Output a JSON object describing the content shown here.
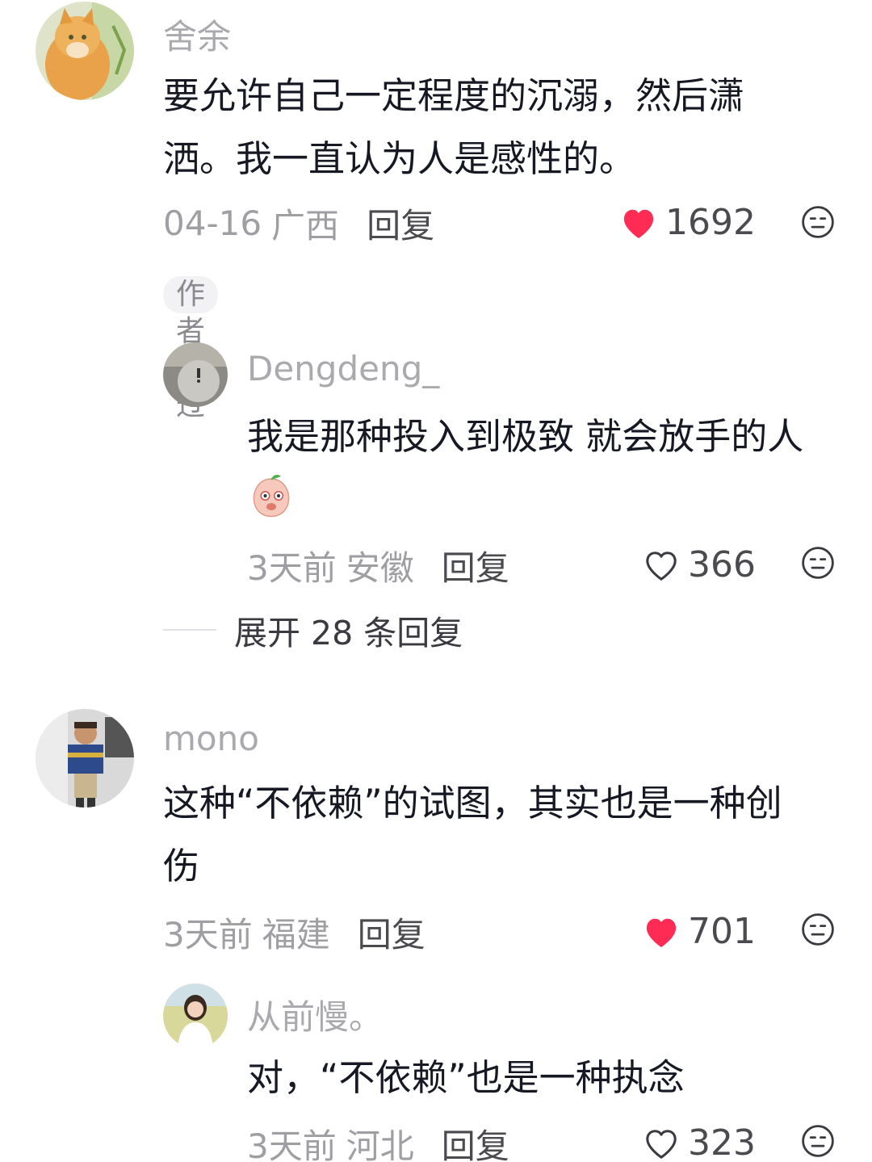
{
  "comments": [
    {
      "username": "舍余",
      "text": "要允许自己一定程度的沉溺，然后潇洒。我一直认为人是感性的。",
      "date": "04-16",
      "location": "广西",
      "reply_label": "回复",
      "likes": "1692",
      "liked": true,
      "badge": "作者赞过"
    },
    {
      "username": "Dengdeng_",
      "text": "我是那种投入到极致 就会放手的人",
      "date": "3天前",
      "location": "安徽",
      "reply_label": "回复",
      "likes": "366",
      "liked": false
    },
    {
      "username": "mono",
      "text": "这种“不依赖”的试图，其实也是一种创伤",
      "date": "3天前",
      "location": "福建",
      "reply_label": "回复",
      "likes": "701",
      "liked": true
    },
    {
      "username": "从前慢。",
      "text": "对，“不依赖”也是一种执念",
      "date": "3天前",
      "location": "河北",
      "reply_label": "回复",
      "likes": "323",
      "liked": false
    }
  ],
  "expand_replies": "展开 28 条回复",
  "icons": {
    "liked": "heart-filled-icon",
    "unliked": "heart-outline-icon",
    "dislike": "meh-face-icon",
    "emoji": "peach-emoji-icon"
  },
  "colors": {
    "like_red": "#fe2c55",
    "text": "#161823",
    "muted": "#9e9ea3"
  }
}
